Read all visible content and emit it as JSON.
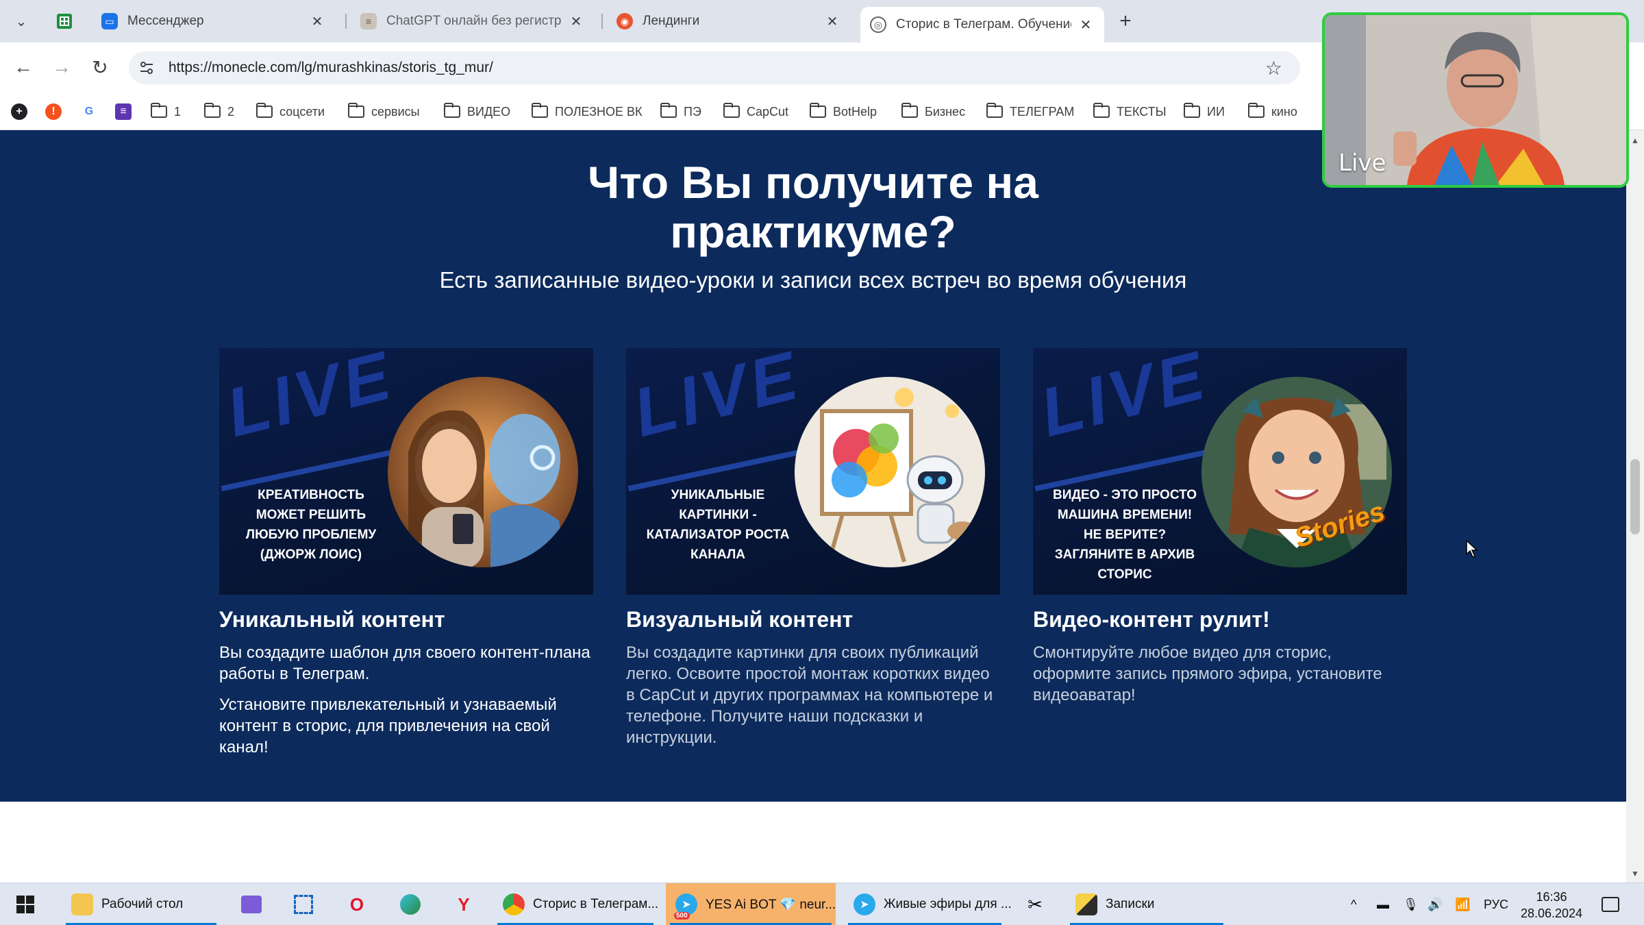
{
  "browser": {
    "tabs": [
      {
        "title": "Мессенджер",
        "active": false
      },
      {
        "title": "ChatGPT онлайн без регистра",
        "active": false
      },
      {
        "title": "Лендинги",
        "active": false
      },
      {
        "title": "Сторис в Телеграм. Обучение",
        "active": true
      }
    ],
    "new_tab": "+",
    "url": "https://monecle.com/lg/murashkinas/storis_tg_mur/",
    "bookmarks": [
      "1",
      "2",
      "соцсети",
      "сервисы",
      "ВИДЕО",
      "ПОЛЕЗНОЕ ВК",
      "ПЭ",
      "CapCut",
      "BotHelp",
      "Бизнес",
      "ТЕЛЕГРАМ",
      "ТЕКСТЫ",
      "ИИ",
      "кино"
    ]
  },
  "webcam": {
    "label": "Live"
  },
  "page": {
    "headline_line1": "Что Вы получите на",
    "headline_line2": "практикуме?",
    "subheadline": "Есть записанные видео-уроки и записи всех встреч во время обучения",
    "cards": [
      {
        "image_caption": "Креативность может решить любую проблему (Джорж Лоис)",
        "title": "Уникальный контент",
        "paragraphs": [
          "Вы создадите шаблон для своего контент-плана работы в Телеграм.",
          "Установите привлекательный и узнаваемый контент в сторис, для привлечения на свой канал!"
        ]
      },
      {
        "image_caption": "Уникальные картинки - катализатор роста канала",
        "title": "Визуальный контент",
        "paragraphs": [
          "Вы создадите картинки для своих публикаций легко. Освоите простой монтаж коротких видео в CapCut и других программах на компьютере и телефоне. Получите наши подсказки и инструкции."
        ]
      },
      {
        "image_caption": "Видео - это просто машина времени! Не верите? Загляните в архив сторис",
        "title": "Видео-контент рулит!",
        "paragraphs": [
          "Смонтируйте любое видео для сторис, оформите запись прямого эфира, установите видеоаватар!"
        ]
      }
    ],
    "image_badge_text": "LIVE",
    "stories_sticker": "Stories"
  },
  "taskbar": {
    "desktop": "Рабочий стол",
    "chrome_window": "Сторис в Телеграм...",
    "bot_window": "YES Ai BOT 💎 neur...",
    "bot_badge": "500",
    "telegram_window": "Живые эфиры для ...",
    "notes_window": "Записки",
    "language": "РУС",
    "time": "16:36",
    "date": "28.06.2024"
  },
  "colors": {
    "section_bg": "#0c2b5c",
    "webcam_border": "#2ecc40",
    "tab_active": "#ffffff"
  }
}
